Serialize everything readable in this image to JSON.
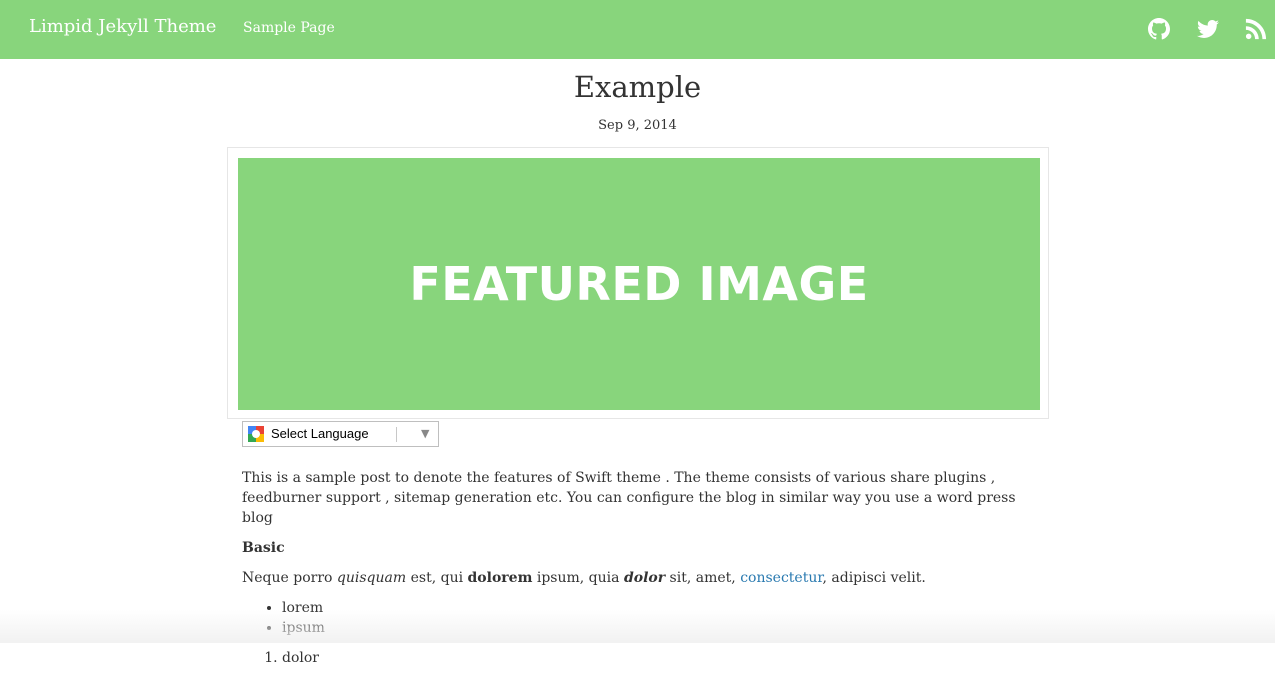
{
  "navbar": {
    "brand": "Limpid Jekyll Theme",
    "links": [
      {
        "label": "Sample Page"
      }
    ],
    "icons": [
      "github-icon",
      "twitter-icon",
      "rss-icon"
    ],
    "background": "#88d57c"
  },
  "post": {
    "title": "Example",
    "date": "Sep 9, 2014",
    "featured_image_text": "FEATURED IMAGE"
  },
  "translate": {
    "label": "Select Language",
    "arrow": "▼"
  },
  "article": {
    "intro": "This is a sample post to denote the features of Swift theme . The theme consists of various share plugins , feedburner support , sitemap generation etc. You can configure the blog in similar way you use a word press blog",
    "heading_basic": "Basic",
    "p2": {
      "t1": "Neque porro ",
      "em1": "quisquam",
      "t2": " est, qui ",
      "strong1": "dolorem",
      "t3": " ipsum, quia ",
      "strongem": "dolor",
      "t4": " sit, amet, ",
      "link": "consectetur",
      "t5": ", adipisci velit."
    },
    "ul": [
      "lorem",
      "ipsum"
    ],
    "ol": [
      "dolor"
    ]
  },
  "colors": {
    "accent": "#88d57c",
    "link": "#2a7ab0",
    "text": "#333333"
  }
}
